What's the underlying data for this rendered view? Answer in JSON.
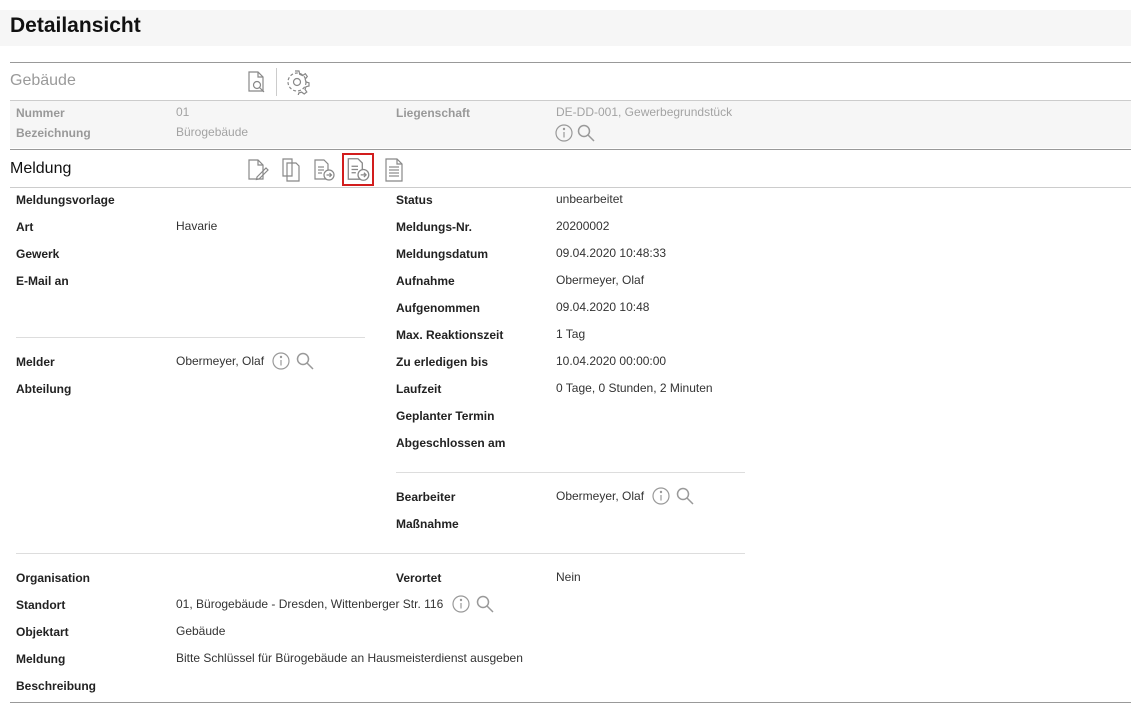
{
  "page": {
    "title": "Detailansicht"
  },
  "gebaeude": {
    "title": "Gebäude",
    "nummer_label": "Nummer",
    "nummer_value": "01",
    "bezeichnung_label": "Bezeichnung",
    "bezeichnung_value": "Bürogebäude",
    "liegenschaft_label": "Liegenschaft",
    "liegenschaft_value": "DE-DD-001, Gewerbegrundstück"
  },
  "meldung": {
    "title": "Meldung",
    "left": {
      "meldungsvorlage_label": "Meldungsvorlage",
      "art_label": "Art",
      "art_value": "Havarie",
      "gewerk_label": "Gewerk",
      "email_label": "E-Mail an",
      "melder_label": "Melder",
      "melder_value": "Obermeyer, Olaf",
      "abteilung_label": "Abteilung"
    },
    "right": {
      "status_label": "Status",
      "status_value": "unbearbeitet",
      "nr_label": "Meldungs-Nr.",
      "nr_value": "20200002",
      "datum_label": "Meldungsdatum",
      "datum_value": "09.04.2020 10:48:33",
      "aufnahme_label": "Aufnahme",
      "aufnahme_value": "Obermeyer, Olaf",
      "aufgenommen_label": "Aufgenommen",
      "aufgenommen_value": "09.04.2020 10:48",
      "reaktion_label": "Max. Reaktionszeit",
      "reaktion_value": "1 Tag",
      "erledigen_label": "Zu erledigen bis",
      "erledigen_value": "10.04.2020 00:00:00",
      "laufzeit_label": "Laufzeit",
      "laufzeit_value": "0 Tage, 0 Stunden, 2 Minuten",
      "termin_label": "Geplanter Termin",
      "abgeschlossen_label": "Abgeschlossen am",
      "bearbeiter_label": "Bearbeiter",
      "bearbeiter_value": "Obermeyer, Olaf",
      "massnahme_label": "Maßnahme"
    },
    "bottom": {
      "organisation_label": "Organisation",
      "verortet_label": "Verortet",
      "verortet_value": "Nein",
      "standort_label": "Standort",
      "standort_value": "01, Bürogebäude - Dresden, Wittenberger Str. 116",
      "objektart_label": "Objektart",
      "objektart_value": "Gebäude",
      "meldung_label": "Meldung",
      "meldung_value": "Bitte Schlüssel für Bürogebäude an Hausmeisterdienst ausgeben",
      "beschreibung_label": "Beschreibung"
    }
  },
  "colors": {
    "accent_border": "#d21d1d",
    "icon_gray": "#888888",
    "band": "#f6f6f6"
  }
}
